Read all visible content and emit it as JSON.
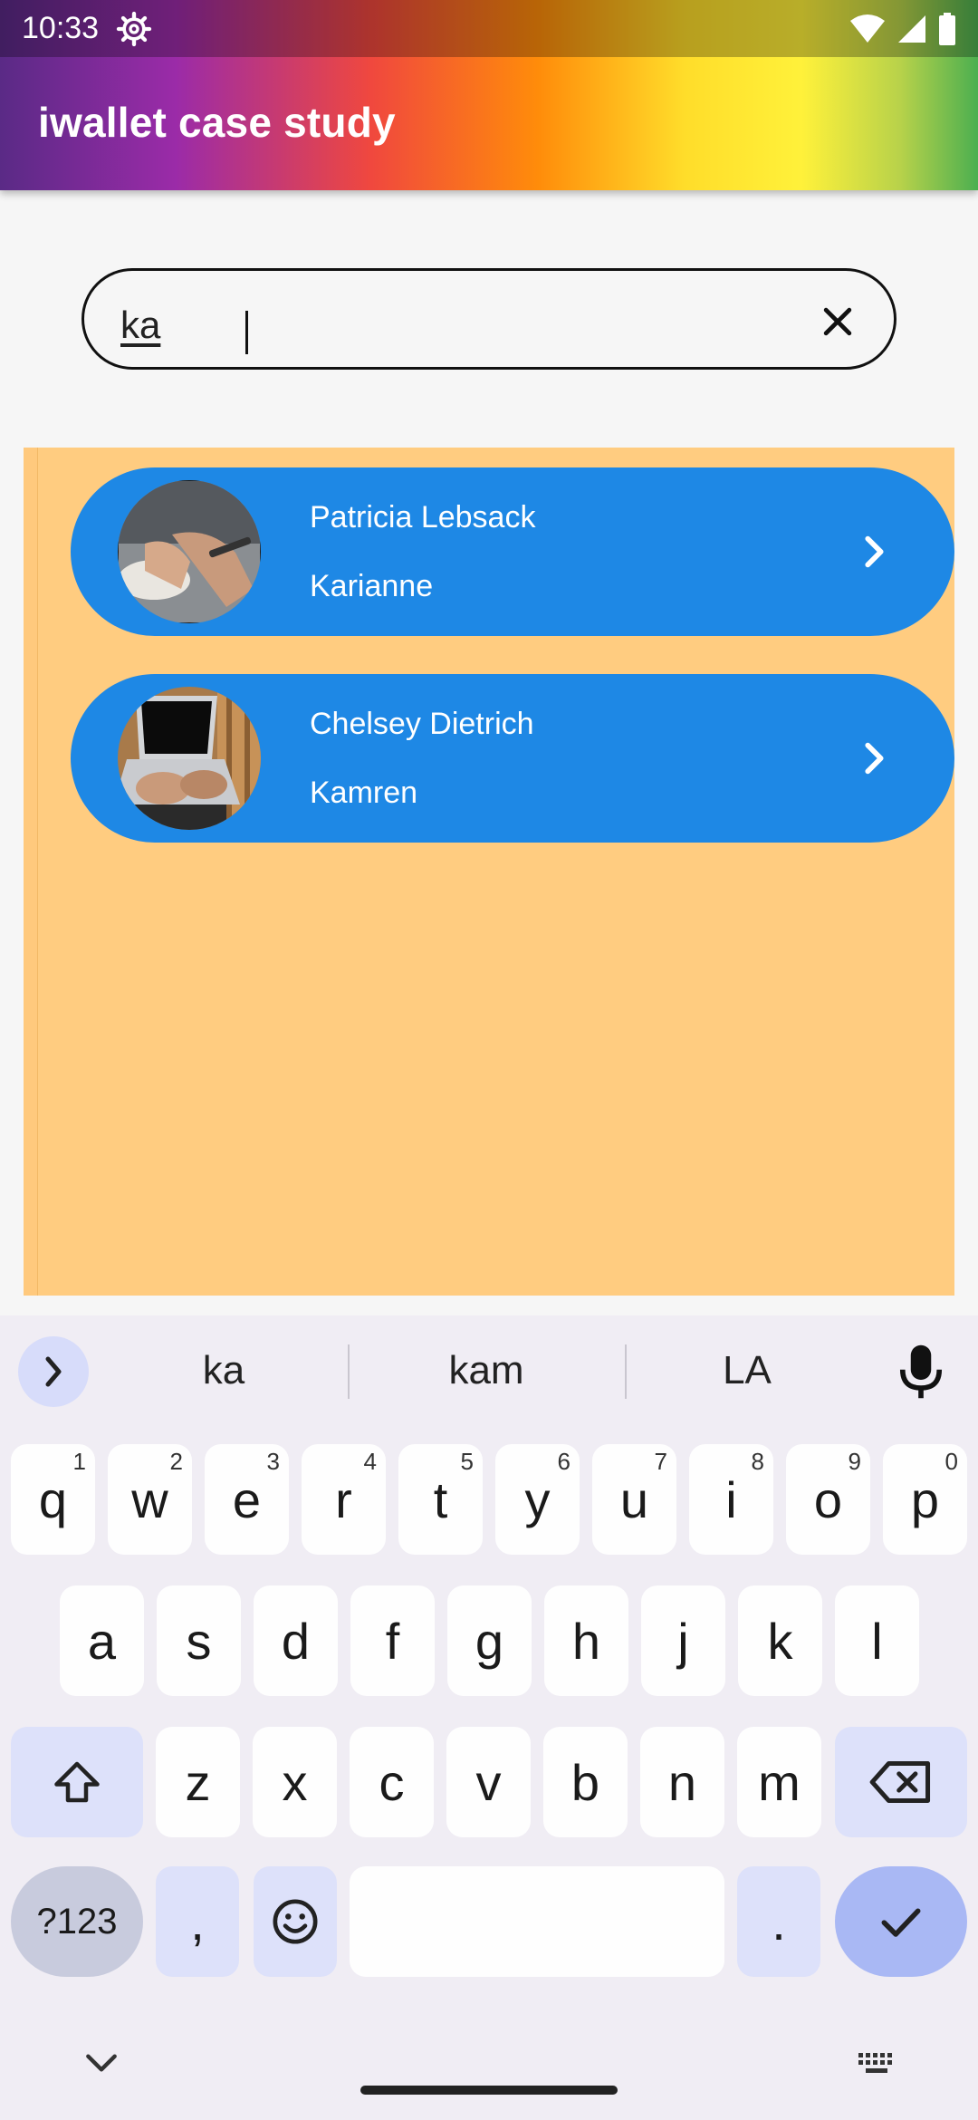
{
  "status_bar": {
    "time": "10:33",
    "icons": [
      "settings-gear-icon",
      "wifi-icon",
      "signal-icon",
      "battery-icon"
    ]
  },
  "app_bar": {
    "title": "iwallet case study",
    "gradient_colors": [
      "#5a2a86",
      "#9b2ba8",
      "#f0483e",
      "#ff8c0a",
      "#ffdd2a",
      "#fff13a",
      "#b8d24a",
      "#4caf50"
    ]
  },
  "search": {
    "value": "ka",
    "clear_icon": "close-icon"
  },
  "results": [
    {
      "name": "Patricia Lebsack",
      "subtitle": "Karianne",
      "avatar": "hands-writing-photo"
    },
    {
      "name": "Chelsey Dietrich",
      "subtitle": "Kamren",
      "avatar": "laptop-typing-photo"
    }
  ],
  "colors": {
    "panel": "#ffcc80",
    "card": "#1e88e5",
    "keyboard_bg": "#f0edf4"
  },
  "keyboard": {
    "suggestions": [
      "ka",
      "kam",
      "LA"
    ],
    "row1": [
      {
        "k": "q",
        "n": "1"
      },
      {
        "k": "w",
        "n": "2"
      },
      {
        "k": "e",
        "n": "3"
      },
      {
        "k": "r",
        "n": "4"
      },
      {
        "k": "t",
        "n": "5"
      },
      {
        "k": "y",
        "n": "6"
      },
      {
        "k": "u",
        "n": "7"
      },
      {
        "k": "i",
        "n": "8"
      },
      {
        "k": "o",
        "n": "9"
      },
      {
        "k": "p",
        "n": "0"
      }
    ],
    "row2": [
      "a",
      "s",
      "d",
      "f",
      "g",
      "h",
      "j",
      "k",
      "l"
    ],
    "row3": [
      "z",
      "x",
      "c",
      "v",
      "b",
      "n",
      "m"
    ],
    "symbols_label": "?123",
    "comma_label": ",",
    "period_label": "."
  }
}
